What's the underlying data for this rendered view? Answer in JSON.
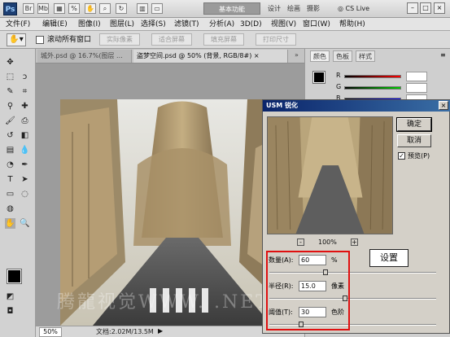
{
  "app": {
    "logo": "Ps",
    "workspace_label": "基本功能",
    "workspace_buttons": [
      "设计",
      "绘画",
      "摄影"
    ],
    "cs_live": "CS Live",
    "window_controls": [
      "–",
      "□",
      "×"
    ]
  },
  "menu": [
    "文件(F)",
    "编辑(E)",
    "图像(I)",
    "图层(L)",
    "选择(S)",
    "滤镜(T)",
    "分析(A)",
    "3D(D)",
    "视图(V)",
    "窗口(W)",
    "帮助(H)"
  ],
  "options_bar": {
    "checkbox_label": "滚动所有窗口",
    "buttons": [
      "实际像素",
      "适合屏幕",
      "填充屏幕",
      "打印尺寸"
    ]
  },
  "tabs": [
    {
      "label": "城外.psd @ 16.7%(图层 ..."
    },
    {
      "label": "盗梦空间.psd @ 50% (背景, RGB/8#) ×"
    }
  ],
  "status": {
    "zoom": "50%",
    "doc_info": "文档:2.02M/13.5M"
  },
  "panels": {
    "tabs": [
      "颜色",
      "色板",
      "样式"
    ],
    "channels": [
      "R",
      "G",
      "B"
    ]
  },
  "dialog": {
    "title": "USM 锐化",
    "ok_label": "确定",
    "cancel_label": "取消",
    "preview_label": "预览(P)",
    "zoom": "100%",
    "zoom_minus": "-",
    "zoom_plus": "+",
    "amount_label": "数量(A):",
    "amount_value": "60",
    "amount_unit": "%",
    "radius_label": "半径(R):",
    "radius_value": "15.0",
    "radius_unit": "像素",
    "threshold_label": "阈值(T):",
    "threshold_value": "30",
    "threshold_unit": "色阶"
  },
  "annotation": {
    "setting_label": "设置"
  },
  "watermark": "腾龍视觉WWW.    .NET",
  "colors": {
    "accent_red": "#e01010",
    "dialog_title_blue": "#0a246a"
  }
}
